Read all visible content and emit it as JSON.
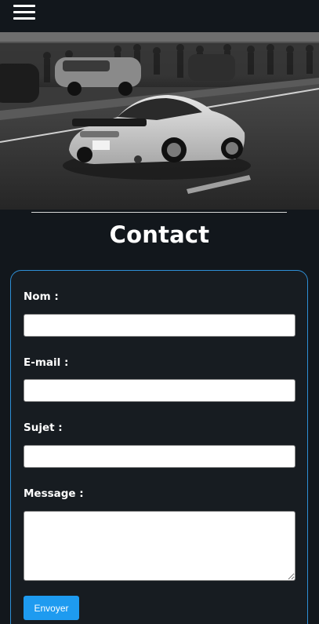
{
  "nav": {
    "menu_icon": "hamburger-menu-icon"
  },
  "hero": {
    "image": "black-and-white photo of a white sports car driving on a track with spectators"
  },
  "page": {
    "title": "Contact"
  },
  "form": {
    "fields": [
      {
        "label": "Nom :",
        "value": "",
        "placeholder": ""
      },
      {
        "label": "E-mail :",
        "value": "",
        "placeholder": ""
      },
      {
        "label": "Sujet :",
        "value": "",
        "placeholder": ""
      }
    ],
    "message": {
      "label": "Message :",
      "value": "",
      "placeholder": ""
    },
    "submit_label": "Envoyer"
  },
  "colors": {
    "background": "#12171c",
    "card_border": "#2e8fd6",
    "button": "#1e9bf0",
    "text": "#ffffff"
  }
}
